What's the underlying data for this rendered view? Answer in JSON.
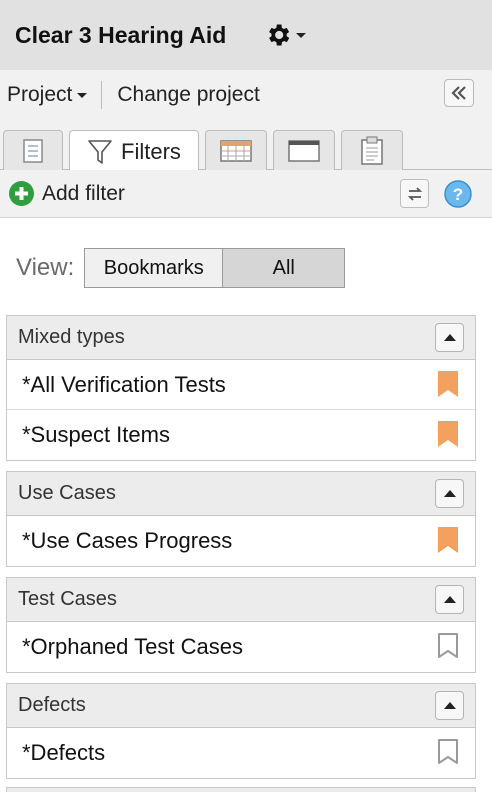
{
  "header": {
    "title": "Clear 3 Hearing Aid",
    "settings_icon": "gear-icon"
  },
  "project_bar": {
    "project_label": "Project",
    "change_label": "Change project",
    "collapse_icon": "double-chevron-left-icon"
  },
  "tabs": [
    {
      "icon": "list-icon",
      "label": ""
    },
    {
      "icon": "filter-icon",
      "label": "Filters",
      "active": true
    },
    {
      "icon": "table-icon",
      "label": ""
    },
    {
      "icon": "window-icon",
      "label": ""
    },
    {
      "icon": "clipboard-icon",
      "label": ""
    }
  ],
  "toolbar": {
    "add_filter_label": "Add filter",
    "add_icon": "plus-circle-icon",
    "swap_icon": "swap-arrows-icon",
    "help_icon": "help-icon"
  },
  "view": {
    "label": "View:",
    "options": [
      "Bookmarks",
      "All"
    ],
    "selected": "All"
  },
  "colors": {
    "bookmark_on": "#f2a15e",
    "bookmark_off": "#9a9a9a",
    "add_green": "#2e9e3e",
    "help_blue": "#4aa3e0"
  },
  "groups": [
    {
      "title": "Mixed types",
      "items": [
        {
          "label": "*All Verification Tests",
          "bookmarked": true
        },
        {
          "label": "*Suspect Items",
          "bookmarked": true
        }
      ]
    },
    {
      "title": "Use Cases",
      "items": [
        {
          "label": "*Use Cases Progress",
          "bookmarked": true
        }
      ]
    },
    {
      "title": "Test Cases",
      "items": [
        {
          "label": "*Orphaned Test Cases",
          "bookmarked": false
        }
      ]
    },
    {
      "title": "Defects",
      "items": [
        {
          "label": "*Defects",
          "bookmarked": false
        }
      ]
    }
  ]
}
